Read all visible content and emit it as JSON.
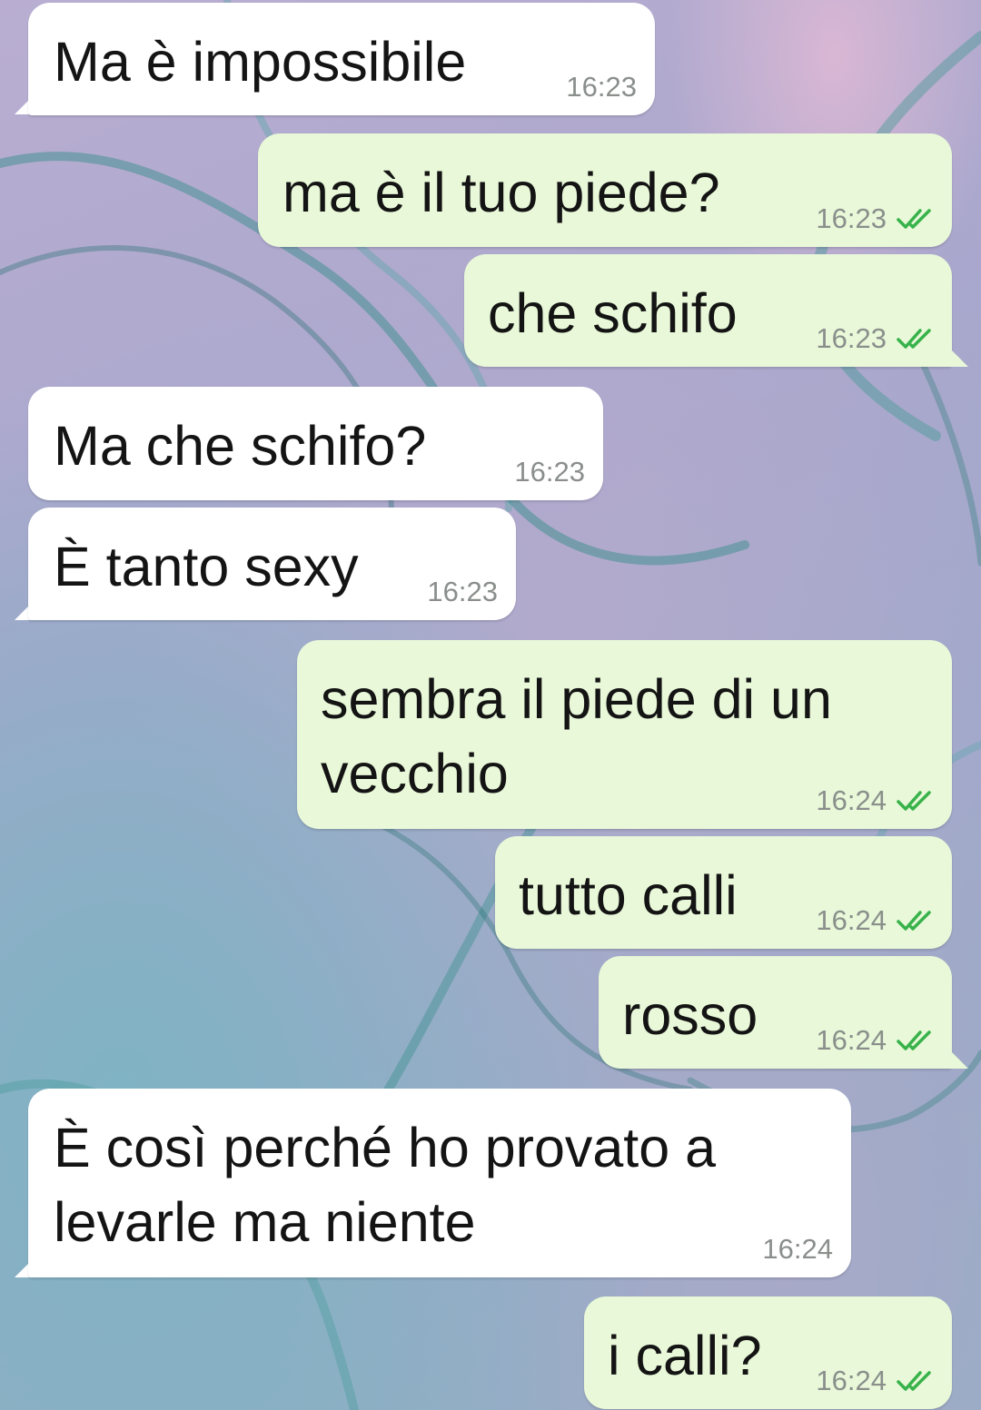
{
  "theme": {
    "incoming_bubble": "#ffffff",
    "outgoing_bubble": "#e8f8d8",
    "read_check_color": "#38b24a"
  },
  "messages": [
    {
      "direction": "incoming",
      "text": "Ma è impossibile",
      "time": "16:23"
    },
    {
      "direction": "outgoing",
      "text": "ma è il tuo piede?",
      "time": "16:23",
      "status_icon": "double-check-read-icon"
    },
    {
      "direction": "outgoing",
      "text": "che schifo",
      "time": "16:23",
      "status_icon": "double-check-read-icon"
    },
    {
      "direction": "incoming",
      "text": "Ma che schifo?",
      "time": "16:23"
    },
    {
      "direction": "incoming",
      "text": "È tanto sexy",
      "time": "16:23"
    },
    {
      "direction": "outgoing",
      "text": "sembra il piede di un\nvecchio",
      "time": "16:24",
      "status_icon": "double-check-read-icon"
    },
    {
      "direction": "outgoing",
      "text": "tutto calli",
      "time": "16:24",
      "status_icon": "double-check-read-icon"
    },
    {
      "direction": "outgoing",
      "text": "rosso",
      "time": "16:24",
      "status_icon": "double-check-read-icon"
    },
    {
      "direction": "incoming",
      "text": "È così perché ho provato a\nlevarle ma niente",
      "time": "16:24"
    },
    {
      "direction": "outgoing",
      "text": "i calli?",
      "time": "16:24",
      "status_icon": "double-check-read-icon"
    }
  ]
}
